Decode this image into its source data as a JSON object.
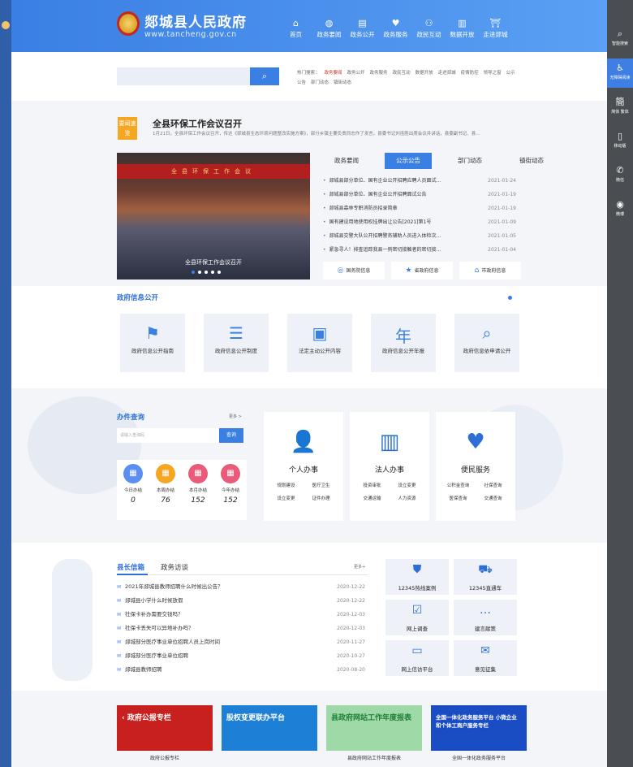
{
  "header": {
    "site_name": "郯城县人民政府",
    "site_url": "www.tancheng.gov.cn",
    "nav": [
      {
        "label": "首页",
        "icon": "home-icon",
        "glyph": "⌂"
      },
      {
        "label": "政务要闻",
        "icon": "globe-icon",
        "glyph": "◍"
      },
      {
        "label": "政务公开",
        "icon": "book-icon",
        "glyph": "▤"
      },
      {
        "label": "政务服务",
        "icon": "heart-icon",
        "glyph": "♥"
      },
      {
        "label": "政民互动",
        "icon": "people-icon",
        "glyph": "⚇"
      },
      {
        "label": "数据开放",
        "icon": "bar-chart-icon",
        "glyph": "▥"
      },
      {
        "label": "走进郯城",
        "icon": "landmark-icon",
        "glyph": "⛩"
      }
    ]
  },
  "right_sidebar": [
    {
      "label": "智能搜索",
      "glyph": "⌕"
    },
    {
      "label": "无障碍阅读",
      "glyph": "♿"
    },
    {
      "label": "简体 繁体",
      "glyph": "簡"
    },
    {
      "label": "移动版",
      "glyph": "▯"
    },
    {
      "label": "微信",
      "glyph": "✆"
    },
    {
      "label": "微博",
      "glyph": "◉"
    }
  ],
  "search": {
    "placeholder": "",
    "button_icon": "search-icon",
    "hot_label": "热门搜索：",
    "hot_terms": [
      "政务要闻",
      "政务公开",
      "政务服务",
      "政民互动",
      "数据开放",
      "走进郯城",
      "疫情防控",
      "领导之窗",
      "公示公告",
      "部门动态",
      "镇街动态"
    ]
  },
  "headline": {
    "tag": "要闻速览",
    "title": "全县环保工作会议召开",
    "summary": "1月21日，全县环保工作会议召开，传达《郯城县生态环境问题整改实施方案》，部分乡镇主要负责同志作了发言。县委书记刘连胜出席会议并讲话，县委副书记、县..."
  },
  "slideshow": {
    "banner": "全县环保工作会议",
    "caption": "全县环保工作会议召开"
  },
  "news_tabs": [
    "政务要闻",
    "公示公告",
    "部门动态",
    "镇街动态"
  ],
  "news_list": [
    {
      "title": "郯城县部分单位、国有企业公开招聘应聘人员面试...",
      "date": "2021-01-24"
    },
    {
      "title": "郯城县部分单位、国有企业公开招聘面试公告",
      "date": "2021-01-19"
    },
    {
      "title": "郯城县森林专职消防员招录简章",
      "date": "2021-01-19"
    },
    {
      "title": "国有建设用地使用权挂牌出让公告[2021]第1号",
      "date": "2021-01-09"
    },
    {
      "title": "郯城县交警大队公开招聘警务辅助人员进入体检次...",
      "date": "2021-01-05"
    },
    {
      "title": "紧急寻人！排查追踪我县一例密切接触者的密切接...",
      "date": "2021-01-04"
    }
  ],
  "shortcuts": [
    {
      "label": "国务院信息",
      "glyph": "◎"
    },
    {
      "label": "省政府信息",
      "glyph": "★"
    },
    {
      "label": "市政府信息",
      "glyph": "⌂"
    }
  ],
  "info_open": {
    "title": "政府信息公开",
    "cards": [
      {
        "label": "政府信息公开指南",
        "glyph": "⚑"
      },
      {
        "label": "政府信息公开制度",
        "glyph": "☰"
      },
      {
        "label": "法定主动公开内容",
        "glyph": "▣"
      },
      {
        "label": "政府信息公开年报",
        "glyph": "年"
      },
      {
        "label": "政府信息依申请公开",
        "glyph": "⌕"
      }
    ]
  },
  "banjian": {
    "title": "办件查询",
    "more": "更多 >",
    "input_placeholder": "请输入查询码",
    "button": "查询",
    "stats": [
      {
        "label": "今日办结",
        "value": "0",
        "color": "#5b8ef0"
      },
      {
        "label": "本周办结",
        "value": "76",
        "color": "#f5a623"
      },
      {
        "label": "本月办结",
        "value": "152",
        "color": "#e95b78"
      },
      {
        "label": "今年办结",
        "value": "152",
        "color": "#e95b78"
      }
    ]
  },
  "services": [
    {
      "title": "个人办事",
      "glyph": "👤",
      "links": [
        "规划建设",
        "医疗卫生",
        "设立变更",
        "证件办理"
      ]
    },
    {
      "title": "法人办事",
      "glyph": "▥",
      "links": [
        "投资审批",
        "设立变更",
        "交通运输",
        "人力资源"
      ]
    },
    {
      "title": "便民服务",
      "glyph": "♥",
      "links": [
        "公积金查询",
        "社保查询",
        "医保查询",
        "交通查询"
      ]
    }
  ],
  "mailbox": {
    "tabs": [
      "县长信箱",
      "政务访谈"
    ],
    "more": "更多+",
    "items": [
      {
        "title": "2021年郯城县教师招聘什么时候出公告？",
        "date": "2020-12-22"
      },
      {
        "title": "郯城县小学什么时候放假",
        "date": "2020-12-22"
      },
      {
        "title": "社保卡补办需要交钱吗？",
        "date": "2020-12-03"
      },
      {
        "title": "社保卡丢失可以异地补办吗？",
        "date": "2020-12-03"
      },
      {
        "title": "郯城部分医疗事业单位招聘人员上岗时间",
        "date": "2020-11-27"
      },
      {
        "title": "郯城部分医疗事业单位招聘",
        "date": "2020-10-27"
      },
      {
        "title": "郯城县教师招聘",
        "date": "2020-08-20"
      }
    ]
  },
  "tiles": [
    {
      "label": "12345热线案例",
      "glyph": "⛊"
    },
    {
      "label": "12345直通车",
      "glyph": "⛟"
    },
    {
      "label": "网上调查",
      "glyph": "☑"
    },
    {
      "label": "建言献策",
      "glyph": "…"
    },
    {
      "label": "网上信访平台",
      "glyph": "▭"
    },
    {
      "label": "意见征集",
      "glyph": "✉"
    }
  ],
  "bottom_banners": [
    {
      "text": "‹ 政府公报专栏",
      "caption": "政府公报专栏",
      "color": "#c8201e"
    },
    {
      "text": "股权变更联办平台",
      "caption": "",
      "color": "#1e7fd6"
    },
    {
      "text": "县政府网站工作年度报表",
      "caption": "县政府网站工作年度报表",
      "color": "#9fd9a8"
    },
    {
      "text": "全国一体化政务服务平台 小微企业和个体工商户服务专栏",
      "caption": "全国一体化政务服务平台",
      "color": "#1a4cc4"
    }
  ]
}
